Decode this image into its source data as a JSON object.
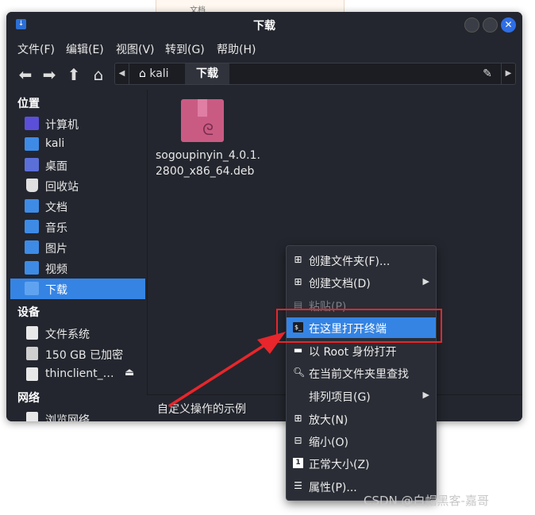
{
  "background_doc": {
    "text": "文档"
  },
  "window": {
    "title": "下载"
  },
  "menubar": [
    {
      "label": "文件(F)"
    },
    {
      "label": "编辑(E)"
    },
    {
      "label": "视图(V)"
    },
    {
      "label": "转到(G)"
    },
    {
      "label": "帮助(H)"
    }
  ],
  "toolbar": {
    "back_icon": "arrow-left-icon",
    "forward_icon": "arrow-right-icon",
    "up_icon": "arrow-up-icon",
    "home_icon": "home-icon",
    "path": [
      {
        "label": "kali"
      },
      {
        "label": "下载"
      }
    ]
  },
  "sidebar": {
    "places_heading": "位置",
    "places": [
      {
        "label": "计算机",
        "icon": "computer-icon",
        "color": "#5b4fd9"
      },
      {
        "label": "kali",
        "icon": "home-folder-icon",
        "color": "#3e8be6"
      },
      {
        "label": "桌面",
        "icon": "desktop-folder-icon",
        "color": "#5b6fd9"
      },
      {
        "label": "回收站",
        "icon": "trash-icon",
        "color": "#e0e0e0"
      },
      {
        "label": "文档",
        "icon": "documents-folder-icon",
        "color": "#3e8be6"
      },
      {
        "label": "音乐",
        "icon": "music-folder-icon",
        "color": "#3e8be6"
      },
      {
        "label": "图片",
        "icon": "pictures-folder-icon",
        "color": "#3e8be6"
      },
      {
        "label": "视频",
        "icon": "videos-folder-icon",
        "color": "#3e8be6"
      },
      {
        "label": "下载",
        "icon": "downloads-folder-icon",
        "color": "#3e8be6"
      }
    ],
    "devices_heading": "设备",
    "devices": [
      {
        "label": "文件系统",
        "icon": "drive-icon",
        "color": "#e8e8e8"
      },
      {
        "label": "150 GB 已加密",
        "icon": "drive-icon",
        "color": "#cfcfcf"
      },
      {
        "label": "thinclient_…",
        "icon": "removable-drive-icon",
        "color": "#e8e8e8",
        "eject": "⏏"
      }
    ],
    "network_heading": "网络",
    "network": [
      {
        "label": "浏览网络",
        "icon": "network-icon",
        "color": "#e8e8e8"
      }
    ]
  },
  "content": {
    "file": {
      "name": "sogoupinyin_4.0.1.2800_x86_64.deb",
      "line1": "sogoupinyin_4.0.1.",
      "line2": "2800_x86_64.deb",
      "icon": "deb-package-icon",
      "color": "#c95b83"
    }
  },
  "statusbar": {
    "text": "自定义操作的示例"
  },
  "context_menu": [
    {
      "label": "创建文件夹(F)...",
      "icon": "plus-icon",
      "submenu": false,
      "disabled": false,
      "highlight": false
    },
    {
      "label": "创建文档(D)",
      "icon": "plus-icon",
      "submenu": true,
      "disabled": false,
      "highlight": false
    },
    {
      "label": "粘贴(P)",
      "icon": "paste-icon",
      "submenu": false,
      "disabled": true,
      "highlight": false
    },
    {
      "label": "在这里打开终端",
      "icon": "terminal-icon",
      "submenu": false,
      "disabled": false,
      "highlight": true
    },
    {
      "label": "以 Root 身份打开",
      "icon": "folder-icon",
      "submenu": false,
      "disabled": false,
      "highlight": false
    },
    {
      "label": "在当前文件夹里查找",
      "icon": "search-icon",
      "submenu": false,
      "disabled": false,
      "highlight": false
    },
    {
      "label": "排列项目(G)",
      "icon": "",
      "submenu": true,
      "disabled": false,
      "highlight": false
    },
    {
      "label": "放大(N)",
      "icon": "zoom-in-icon",
      "submenu": false,
      "disabled": false,
      "highlight": false
    },
    {
      "label": "缩小(O)",
      "icon": "zoom-out-icon",
      "submenu": false,
      "disabled": false,
      "highlight": false
    },
    {
      "label": "正常大小(Z)",
      "icon": "zoom-normal-icon",
      "submenu": false,
      "disabled": false,
      "highlight": false
    },
    {
      "label": "属性(P)...",
      "icon": "properties-icon",
      "submenu": false,
      "disabled": false,
      "highlight": false
    }
  ],
  "annotation": {
    "color": "#e8262b"
  },
  "watermark": {
    "text": "CSDN @白帽黑客-嘉哥"
  }
}
